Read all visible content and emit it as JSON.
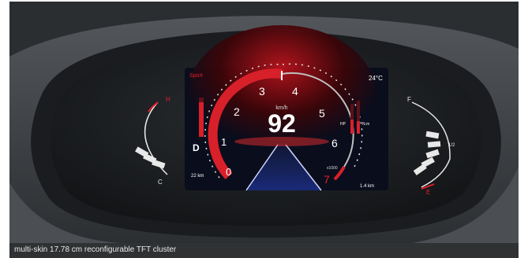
{
  "caption": "multi-skin 17.78 cm reconfigurable TFT cluster",
  "display": {
    "mode": "Sport",
    "outside_temp": "24°C",
    "speed": "92",
    "speed_unit": "km/h",
    "speed_scale": [
      "0",
      "1",
      "2",
      "3",
      "4",
      "5",
      "6",
      "7"
    ],
    "rpm_multiplier": "x1000",
    "gear": "D",
    "range": "22 km",
    "trip": "1.4 km",
    "power_label": "HP",
    "torque_label": "N.m"
  },
  "temp_gauge": {
    "hot_label": "H",
    "cold_label": "C"
  },
  "fuel_gauge": {
    "full_label": "F",
    "half_label": "1/2",
    "empty_label": "E"
  },
  "colors": {
    "accent": "#e0202a",
    "screen": "#0a0d1c",
    "housing": "#1e2124"
  }
}
